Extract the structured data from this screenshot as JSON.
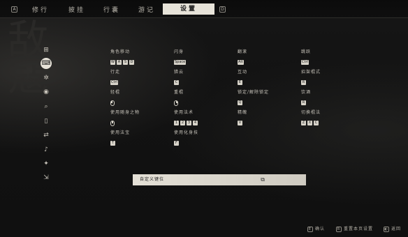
{
  "nav": {
    "left_key": "A",
    "right_key": "D",
    "tabs": [
      "修行",
      "披挂",
      "行囊",
      "游记",
      "设置"
    ],
    "active_tab": "设置"
  },
  "rail": {
    "icons": [
      "gamepad-icon",
      "keyboard-icon",
      "gear-icon",
      "eye-icon",
      "magnifier-icon",
      "mouse-icon",
      "swap-icon",
      "speaker-icon",
      "figure-icon",
      "exit-icon"
    ],
    "active_index": 1,
    "active_label": "键鼠"
  },
  "settings": {
    "move": {
      "label": "角色移动",
      "keys": [
        "W",
        "A",
        "S",
        "D"
      ]
    },
    "dodge": {
      "label": "闪身",
      "keys": [
        "Space"
      ]
    },
    "jump": {
      "label": "翻滚",
      "keys": [
        "Alt"
      ]
    },
    "sprint": {
      "label": "跳跃",
      "keys": [
        "Ctrl"
      ]
    },
    "walk": {
      "label": "行走",
      "keys": [
        "Ctrl"
      ]
    },
    "interact": {
      "label": "猎云",
      "keys": [
        "C"
      ]
    },
    "interact2": {
      "label": "互动",
      "keys": [
        "E"
      ]
    },
    "stance": {
      "label": "招架棍式",
      "keys": [
        "R"
      ]
    },
    "light": {
      "label": "轻棍",
      "mouse": "left"
    },
    "heavy": {
      "label": "重棍",
      "mouse": "right"
    },
    "lock": {
      "label": "锁定/解除锁定",
      "keys": [
        "Q"
      ]
    },
    "gourd": {
      "label": "饮酒",
      "keys": [
        "R"
      ]
    },
    "item": {
      "label": "使用随身之物",
      "mouse": "mid"
    },
    "spell": {
      "label": "使用法术",
      "keys": [
        "1",
        "2",
        "3",
        "4"
      ]
    },
    "spirit": {
      "label": "精魄",
      "keys": [
        "V"
      ]
    },
    "switch": {
      "label": "切换棍法",
      "keys": [
        "Z",
        "X",
        "C"
      ]
    },
    "magic": {
      "label": "使用法宝",
      "keys": [
        "T"
      ]
    },
    "transform": {
      "label": "使用化身技",
      "keys": [
        "F"
      ]
    }
  },
  "custom_bar": {
    "label": "自定义键位"
  },
  "footer": {
    "confirm_key": "E",
    "confirm_label": "确认",
    "reset_key": "R",
    "reset_label": "重置本页设置",
    "back_label": "返回"
  }
}
